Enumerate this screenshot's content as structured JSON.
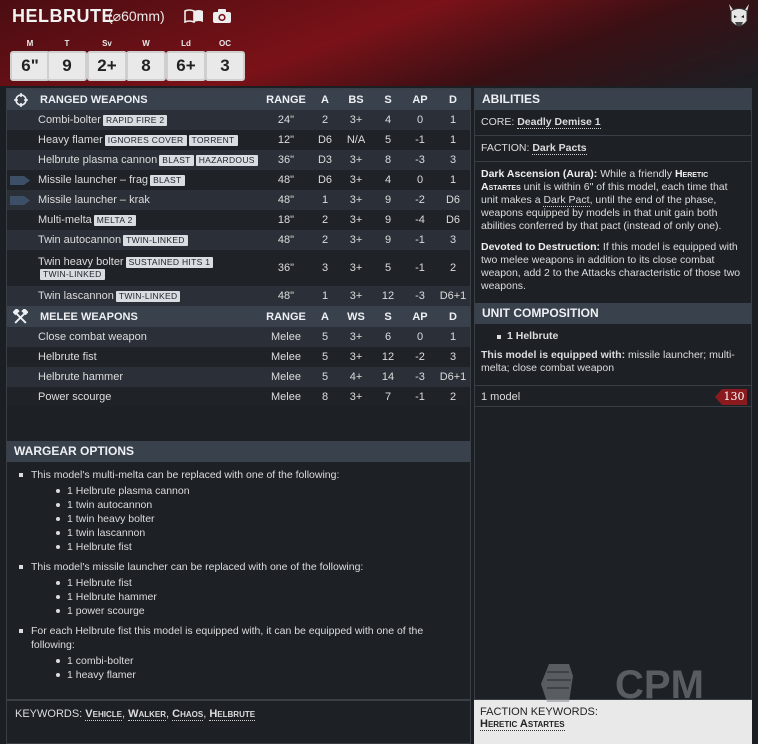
{
  "unit": {
    "name": "HELBRUTE",
    "base_size": "(⌀60mm)"
  },
  "stats": [
    {
      "label": "M",
      "value": "6\""
    },
    {
      "label": "T",
      "value": "9"
    },
    {
      "label": "Sv",
      "value": "2+"
    },
    {
      "label": "W",
      "value": "8"
    },
    {
      "label": "Ld",
      "value": "6+"
    },
    {
      "label": "OC",
      "value": "3"
    }
  ],
  "ranged": {
    "header": [
      "RANGED WEAPONS",
      "RANGE",
      "A",
      "BS",
      "S",
      "AP",
      "D"
    ],
    "rows": [
      {
        "name": "Combi-bolter",
        "kw": [
          "RAPID FIRE 2"
        ],
        "range": "24\"",
        "a": "2",
        "bs": "3+",
        "s": "4",
        "ap": "0",
        "d": "1"
      },
      {
        "name": "Heavy flamer",
        "kw": [
          "IGNORES COVER",
          "TORRENT"
        ],
        "range": "12\"",
        "a": "D6",
        "bs": "N/A",
        "s": "5",
        "ap": "-1",
        "d": "1"
      },
      {
        "name": "Helbrute plasma cannon",
        "kw": [
          "BLAST",
          "HAZARDOUS"
        ],
        "range": "36\"",
        "a": "D3",
        "bs": "3+",
        "s": "8",
        "ap": "-3",
        "d": "3"
      },
      {
        "name": "Missile launcher – frag",
        "kw": [
          "BLAST"
        ],
        "range": "48\"",
        "a": "D6",
        "bs": "3+",
        "s": "4",
        "ap": "0",
        "d": "1"
      },
      {
        "name": "Missile launcher – krak",
        "kw": [],
        "range": "48\"",
        "a": "1",
        "bs": "3+",
        "s": "9",
        "ap": "-2",
        "d": "D6"
      },
      {
        "name": "Multi-melta",
        "kw": [
          "MELTA 2"
        ],
        "range": "18\"",
        "a": "2",
        "bs": "3+",
        "s": "9",
        "ap": "-4",
        "d": "D6"
      },
      {
        "name": "Twin autocannon",
        "kw": [
          "TWIN-LINKED"
        ],
        "range": "48\"",
        "a": "2",
        "bs": "3+",
        "s": "9",
        "ap": "-1",
        "d": "3"
      },
      {
        "name": "Twin heavy bolter",
        "kw": [
          "SUSTAINED HITS 1",
          "TWIN-LINKED"
        ],
        "range": "36\"",
        "a": "3",
        "bs": "3+",
        "s": "5",
        "ap": "-1",
        "d": "2"
      },
      {
        "name": "Twin lascannon",
        "kw": [
          "TWIN-LINKED"
        ],
        "range": "48\"",
        "a": "1",
        "bs": "3+",
        "s": "12",
        "ap": "-3",
        "d": "D6+1"
      }
    ]
  },
  "melee": {
    "header": [
      "MELEE WEAPONS",
      "RANGE",
      "A",
      "WS",
      "S",
      "AP",
      "D"
    ],
    "rows": [
      {
        "name": "Close combat weapon",
        "range": "Melee",
        "a": "5",
        "ws": "3+",
        "s": "6",
        "ap": "0",
        "d": "1"
      },
      {
        "name": "Helbrute fist",
        "range": "Melee",
        "a": "5",
        "ws": "3+",
        "s": "12",
        "ap": "-2",
        "d": "3"
      },
      {
        "name": "Helbrute hammer",
        "range": "Melee",
        "a": "5",
        "ws": "4+",
        "s": "14",
        "ap": "-3",
        "d": "D6+1"
      },
      {
        "name": "Power scourge",
        "range": "Melee",
        "a": "8",
        "ws": "3+",
        "s": "7",
        "ap": "-1",
        "d": "2"
      }
    ]
  },
  "wargear": {
    "title": "WARGEAR OPTIONS",
    "options": [
      {
        "text": "This model's multi-melta can be replaced with one of the following:",
        "items": [
          "1 Helbrute plasma cannon",
          "1 twin autocannon",
          "1 twin heavy bolter",
          "1 twin lascannon",
          "1 Helbrute fist"
        ]
      },
      {
        "text": "This model's missile launcher can be replaced with one of the following:",
        "items": [
          "1 Helbrute fist",
          "1 Helbrute hammer",
          "1 power scourge"
        ]
      },
      {
        "text": "For each Helbrute fist this model is equipped with, it can be equipped with one of the following:",
        "items": [
          "1 combi-bolter",
          "1 heavy flamer"
        ]
      }
    ]
  },
  "abilities": {
    "title": "ABILITIES",
    "core_label": "CORE:",
    "core_value": "Deadly Demise 1",
    "faction_label": "FACTION:",
    "faction_value": "Dark Pacts",
    "dark_ascension_title": "Dark Ascension (Aura):",
    "dark_ascension_1": " While a friendly ",
    "dark_ascension_kw": "Heretic Astartes",
    "dark_ascension_2": " unit is within 6\" of this model, each time that unit makes a ",
    "dark_ascension_link": "Dark Pact",
    "dark_ascension_3": ", until the end of the phase, weapons equipped by models in that unit gain both abilities conferred by that pact (instead of only one).",
    "devoted_title": "Devoted to Destruction:",
    "devoted_text": " If this model is equipped with two melee weapons in addition to its close combat weapon, add 2 to the Attacks characteristic of those two weapons."
  },
  "composition": {
    "title": "UNIT COMPOSITION",
    "bullet": "1 Helbrute",
    "equipped_label": "This model is equipped with:",
    "equipped_text": " missile launcher; multi-melta; close combat weapon",
    "models": "1 model",
    "points": "130"
  },
  "keywords": {
    "label": "KEYWORDS:",
    "items": [
      "Vehicle",
      "Walker",
      "Chaos",
      "Helbrute"
    ]
  },
  "faction_keywords": {
    "label": "FACTION KEYWORDS:",
    "value": "Heretic Astartes"
  },
  "watermark": "CPM"
}
